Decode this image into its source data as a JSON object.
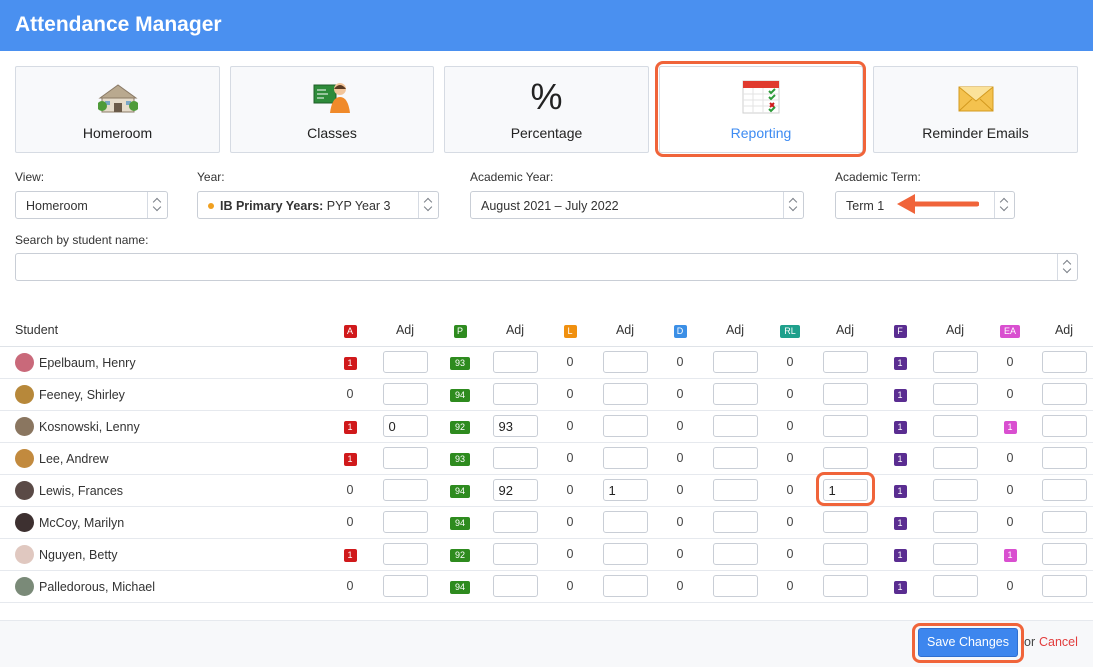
{
  "app": {
    "title": "Attendance Manager",
    "accent": "#4a90f0"
  },
  "cards": [
    {
      "label": "Homeroom",
      "icon": "school-building-icon"
    },
    {
      "label": "Classes",
      "icon": "teacher-chalkboard-icon"
    },
    {
      "label": "Percentage",
      "icon": "percent-icon"
    },
    {
      "label": "Reporting",
      "icon": "calendar-report-icon",
      "active": true
    },
    {
      "label": "Reminder Emails",
      "icon": "envelope-icon"
    }
  ],
  "filters": {
    "view_label": "View:",
    "view_value": "Homeroom",
    "year_label": "Year:",
    "year_program": "IB Primary Years:",
    "year_value": "PYP Year 3",
    "academic_year_label": "Academic Year:",
    "academic_year_value": "August 2021 – July 2022",
    "academic_term_label": "Academic Term:",
    "academic_term_value": "Term 1",
    "search_label": "Search by student name:",
    "search_value": ""
  },
  "table": {
    "student_header": "Student",
    "columns": [
      {
        "code": "A",
        "color": "#d0191b"
      },
      {
        "code": "P",
        "color": "#2e8b1f"
      },
      {
        "code": "L",
        "color": "#f0900f"
      },
      {
        "code": "D",
        "color": "#3b8fe6"
      },
      {
        "code": "RL",
        "color": "#1fa08c"
      },
      {
        "code": "F",
        "color": "#5a2d91"
      },
      {
        "code": "EA",
        "color": "#d94fd0"
      }
    ],
    "adj_header": "Adj",
    "rows": [
      {
        "name": "Epelbaum, Henry",
        "avatar": "#c9697a",
        "values": [
          [
            "1",
            ""
          ],
          [
            "93",
            ""
          ],
          [
            "0",
            ""
          ],
          [
            "0",
            ""
          ],
          [
            "0",
            ""
          ],
          [
            "1",
            ""
          ],
          [
            "0",
            ""
          ]
        ]
      },
      {
        "name": "Feeney, Shirley",
        "avatar": "#b7883a",
        "values": [
          [
            "0",
            ""
          ],
          [
            "94",
            ""
          ],
          [
            "0",
            ""
          ],
          [
            "0",
            ""
          ],
          [
            "0",
            ""
          ],
          [
            "1",
            ""
          ],
          [
            "0",
            ""
          ]
        ]
      },
      {
        "name": "Kosnowski, Lenny",
        "avatar": "#8a7660",
        "values": [
          [
            "1",
            "0"
          ],
          [
            "92",
            "93"
          ],
          [
            "0",
            ""
          ],
          [
            "0",
            ""
          ],
          [
            "0",
            ""
          ],
          [
            "1",
            ""
          ],
          [
            "1",
            ""
          ]
        ]
      },
      {
        "name": "Lee, Andrew",
        "avatar": "#c28a3e",
        "values": [
          [
            "1",
            ""
          ],
          [
            "93",
            ""
          ],
          [
            "0",
            ""
          ],
          [
            "0",
            ""
          ],
          [
            "0",
            ""
          ],
          [
            "1",
            ""
          ],
          [
            "0",
            ""
          ]
        ]
      },
      {
        "name": "Lewis, Frances",
        "avatar": "#5a4a46",
        "values": [
          [
            "0",
            ""
          ],
          [
            "94",
            "92"
          ],
          [
            "0",
            "1"
          ],
          [
            "0",
            ""
          ],
          [
            "0",
            "1"
          ],
          [
            "1",
            ""
          ],
          [
            "0",
            ""
          ]
        ]
      },
      {
        "name": "McCoy, Marilyn",
        "avatar": "#3d3030",
        "values": [
          [
            "0",
            ""
          ],
          [
            "94",
            ""
          ],
          [
            "0",
            ""
          ],
          [
            "0",
            ""
          ],
          [
            "0",
            ""
          ],
          [
            "1",
            ""
          ],
          [
            "0",
            ""
          ]
        ]
      },
      {
        "name": "Nguyen, Betty",
        "avatar": "#e0c8c0",
        "values": [
          [
            "1",
            ""
          ],
          [
            "92",
            ""
          ],
          [
            "0",
            ""
          ],
          [
            "0",
            ""
          ],
          [
            "0",
            ""
          ],
          [
            "1",
            ""
          ],
          [
            "1",
            ""
          ]
        ]
      },
      {
        "name": "Palledorous, Michael",
        "avatar": "#7a8a78",
        "values": [
          [
            "0",
            ""
          ],
          [
            "94",
            ""
          ],
          [
            "0",
            ""
          ],
          [
            "0",
            ""
          ],
          [
            "0",
            ""
          ],
          [
            "1",
            ""
          ],
          [
            "0",
            ""
          ]
        ]
      }
    ]
  },
  "footer": {
    "save_label": "Save Changes",
    "or_text": "or",
    "cancel_label": "Cancel"
  }
}
